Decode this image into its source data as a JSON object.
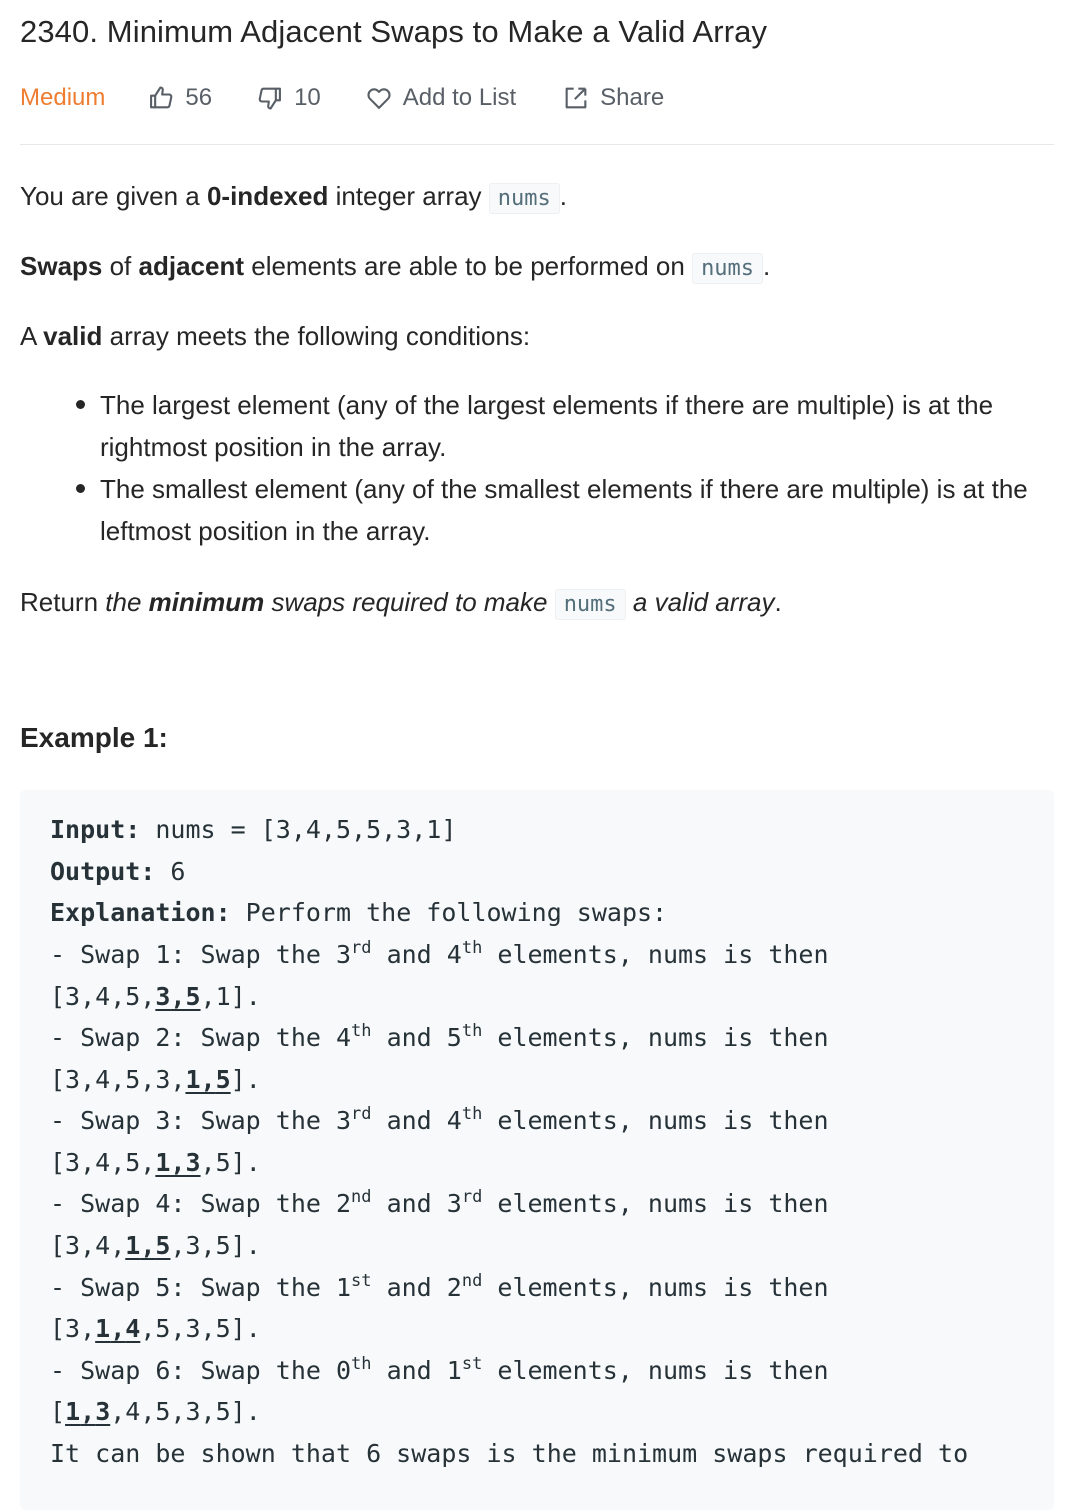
{
  "problem": {
    "title": "2340. Minimum Adjacent Swaps to Make a Valid Array",
    "difficulty": "Medium",
    "likes": "56",
    "dislikes": "10",
    "add_to_list_label": "Add to List",
    "share_label": "Share",
    "difficulty_color": "#ef7d31"
  },
  "description": {
    "p1": {
      "a": "You are given a ",
      "b": "0-indexed",
      "c": " integer array ",
      "code": "nums",
      "d": "."
    },
    "p2": {
      "a": "Swaps",
      "b": " of ",
      "c": "adjacent",
      "d": " elements are able to be performed on ",
      "code": "nums",
      "e": "."
    },
    "p3": {
      "a": "A ",
      "b": "valid",
      "c": " array meets the following conditions:"
    },
    "conditions": [
      "The largest element (any of the largest elements if there are multiple) is at the rightmost position in the array.",
      "The smallest element (any of the smallest elements if there are multiple) is at the leftmost position in the array."
    ],
    "p4": {
      "a": "Return ",
      "b": "the ",
      "c": "minimum",
      "d": " swaps required to make ",
      "code": "nums",
      "e": " a valid array",
      "f": "."
    }
  },
  "example1": {
    "title": "Example 1:",
    "input_label": "Input:",
    "input_value": " nums = [3,4,5,5,3,1]",
    "output_label": "Output:",
    "output_value": " 6",
    "explanation_label": "Explanation:",
    "explanation_value": " Perform the following swaps:",
    "swaps": [
      {
        "prefix": "- Swap 1: Swap the ",
        "n1": "3",
        "s1": "rd",
        "mid": " and ",
        "n2": "4",
        "s2": "th",
        "tail": " elements, nums is then",
        "arr_pre": "[3,4,5,",
        "u1": "3",
        "comma": ",",
        "u2": "5",
        "arr_post": ",1]."
      },
      {
        "prefix": "- Swap 2: Swap the ",
        "n1": "4",
        "s1": "th",
        "mid": " and ",
        "n2": "5",
        "s2": "th",
        "tail": " elements, nums is then",
        "arr_pre": "[3,4,5,3,",
        "u1": "1",
        "comma": ",",
        "u2": "5",
        "arr_post": "]."
      },
      {
        "prefix": "- Swap 3: Swap the ",
        "n1": "3",
        "s1": "rd",
        "mid": " and ",
        "n2": "4",
        "s2": "th",
        "tail": " elements, nums is then",
        "arr_pre": "[3,4,5,",
        "u1": "1",
        "comma": ",",
        "u2": "3",
        "arr_post": ",5]."
      },
      {
        "prefix": "- Swap 4: Swap the ",
        "n1": "2",
        "s1": "nd",
        "mid": " and ",
        "n2": "3",
        "s2": "rd",
        "tail": " elements, nums is then",
        "arr_pre": "[3,4,",
        "u1": "1",
        "comma": ",",
        "u2": "5",
        "arr_post": ",3,5]."
      },
      {
        "prefix": "- Swap 5: Swap the ",
        "n1": "1",
        "s1": "st",
        "mid": " and ",
        "n2": "2",
        "s2": "nd",
        "tail": " elements, nums is then",
        "arr_pre": "[3,",
        "u1": "1",
        "comma": ",",
        "u2": "4",
        "arr_post": ",5,3,5]."
      },
      {
        "prefix": "- Swap 6: Swap the ",
        "n1": "0",
        "s1": "th",
        "mid": " and ",
        "n2": "1",
        "s2": "st",
        "tail": " elements, nums is then",
        "arr_pre": "[",
        "u1": "1",
        "comma": ",",
        "u2": "3",
        "arr_post": ",4,5,3,5]."
      }
    ],
    "closing_line": "It can be shown that 6 swaps is the minimum swaps required to"
  }
}
